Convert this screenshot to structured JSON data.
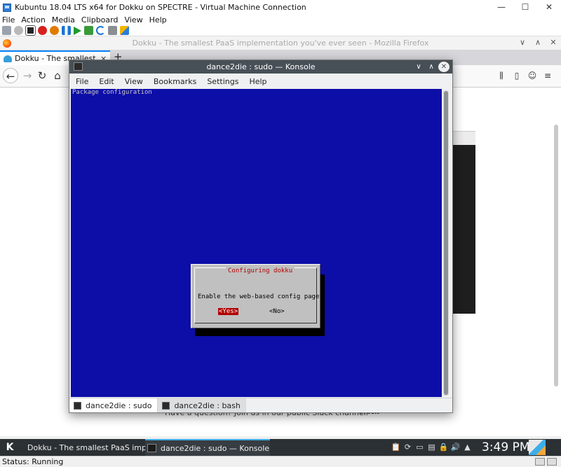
{
  "host_window": {
    "title": "Kubuntu 18.04 LTS x64 for Dokku on SPECTRE - Virtual Machine Connection",
    "menu": [
      "File",
      "Action",
      "Media",
      "Clipboard",
      "View",
      "Help"
    ],
    "toolbar_icons": [
      "ctrl-alt-del-icon",
      "start-icon",
      "turn-off-icon",
      "shutdown-icon",
      "save-icon",
      "pause-icon",
      "resume-icon",
      "checkpoint-icon",
      "revert-icon",
      "enhanced-session-icon",
      "share-icon"
    ],
    "controls": {
      "minimize": "—",
      "maximize": "☐",
      "close": "✕"
    },
    "status": "Status: Running"
  },
  "firefox": {
    "window_title": "Dokku - The smallest PaaS implementation you've ever seen - Mozilla Firefox",
    "tab_label": "Dokku - The smallest PaaS",
    "tab_close": "×",
    "new_tab": "+",
    "controls": {
      "minimize": "∨",
      "maximize": "∧",
      "close": "✕"
    },
    "nav": {
      "back": "←",
      "forward": "→",
      "reload": "↻",
      "home": "⌂"
    },
    "right_icons": {
      "library": "⫼",
      "sidebar": "▯",
      "account": "☺",
      "menu": "≡"
    },
    "footer_text": "Have a question? Join us in our public Slack channel.",
    "footer_logo": "slack"
  },
  "konsole": {
    "title": "dance2die : sudo — Konsole",
    "controls": {
      "minimize": "∨",
      "maximize": "∧",
      "close": "✕"
    },
    "menu": [
      "File",
      "Edit",
      "View",
      "Bookmarks",
      "Settings",
      "Help"
    ],
    "terminal": {
      "header": "Package configuration",
      "dialog": {
        "title": "Configuring dokku",
        "question": "Enable the web-based config page?",
        "yes": "<Yes>",
        "no": "<No>",
        "selected": "yes"
      }
    },
    "tabs": [
      {
        "label": "dance2die : sudo",
        "active": true
      },
      {
        "label": "dance2die : bash",
        "active": false
      }
    ]
  },
  "kde_panel": {
    "start_label": "K",
    "tasks": [
      {
        "label": "Dokku - The smallest PaaS implem...",
        "icon": "firefox-icon"
      },
      {
        "label": "dance2die : sudo — Konsole",
        "icon": "konsole-icon",
        "active": true
      }
    ],
    "tray_icons": [
      "clipboard-icon",
      "updates-icon",
      "display-icon",
      "network-icon",
      "lock-icon",
      "volume-icon",
      "expand-tray-icon"
    ],
    "tray_glyphs": [
      "📋",
      "⟳",
      "▭",
      "▤",
      "🔒",
      "🔊",
      "▲"
    ],
    "clock": "3:49 PM"
  }
}
